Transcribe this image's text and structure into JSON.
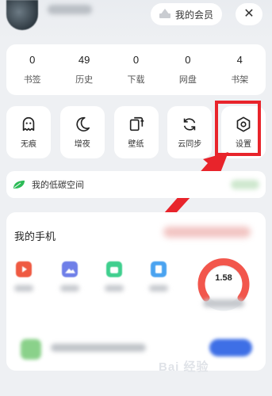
{
  "header": {
    "member_label": "我的会员",
    "close_label": "✕"
  },
  "stats": [
    {
      "value": "0",
      "label": "书签"
    },
    {
      "value": "49",
      "label": "历史"
    },
    {
      "value": "0",
      "label": "下载"
    },
    {
      "value": "0",
      "label": "网盘"
    },
    {
      "value": "4",
      "label": "书架"
    }
  ],
  "tools": [
    {
      "label": "无痕",
      "icon": "ghost-icon"
    },
    {
      "label": "增夜",
      "icon": "moon-icon"
    },
    {
      "label": "壁纸",
      "icon": "wallpaper-icon"
    },
    {
      "label": "云同步",
      "icon": "sync-icon"
    },
    {
      "label": "设置",
      "icon": "settings-icon"
    }
  ],
  "space": {
    "label": "我的低碳空间",
    "icon": "leaf-icon"
  },
  "phone": {
    "title": "我的手机",
    "gauge_value": "1.58",
    "gauge_color": "#f2564c"
  },
  "watermark": "Bai 经验",
  "colors": {
    "highlight": "#e8242b",
    "arrow": "#e8242b",
    "accent_blue": "#3e6fe6",
    "leaf_green": "#2dbb57"
  }
}
